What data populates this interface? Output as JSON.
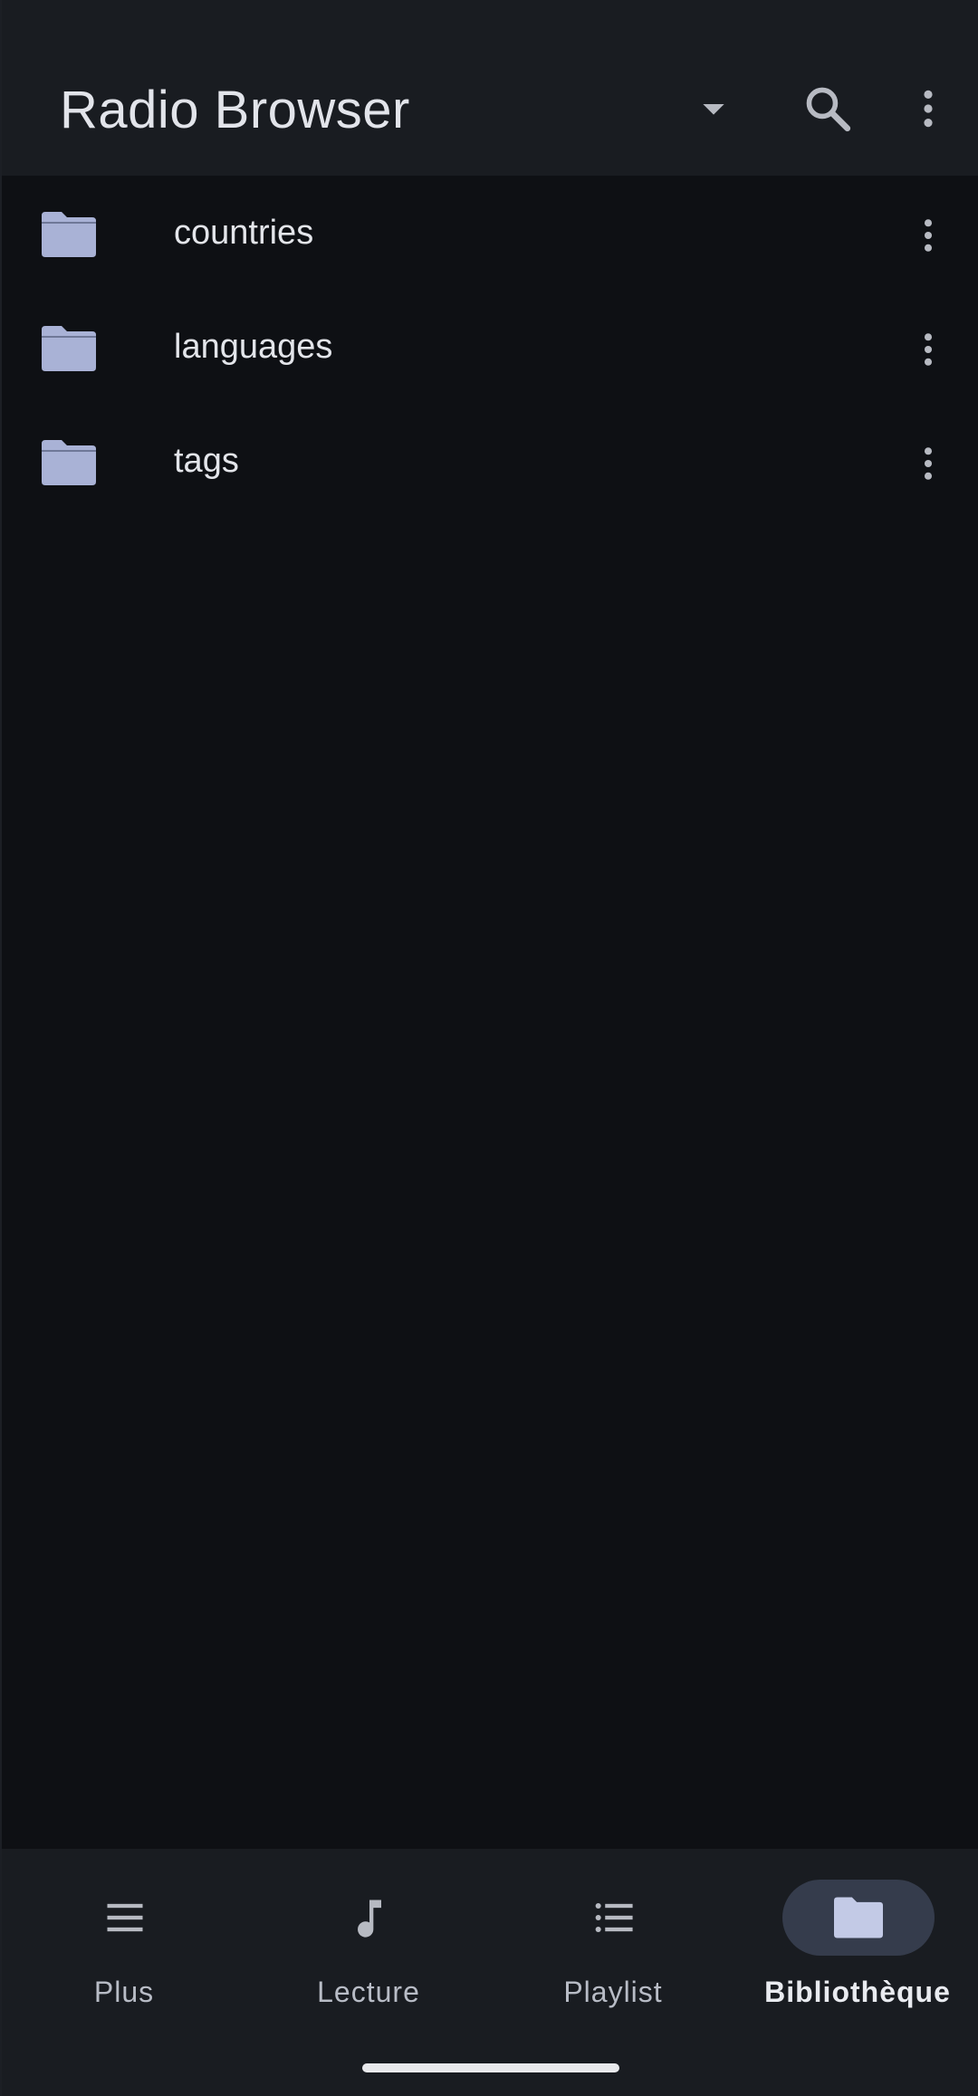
{
  "appbar": {
    "title": "Radio Browser",
    "icons": [
      "dropdown-arrow-icon",
      "search-icon",
      "more-vert-icon"
    ]
  },
  "list": {
    "items": [
      {
        "label": "countries",
        "icon": "folder-icon"
      },
      {
        "label": "languages",
        "icon": "folder-icon"
      },
      {
        "label": "tags",
        "icon": "folder-icon"
      }
    ]
  },
  "bottom_nav": {
    "items": [
      {
        "label": "Plus",
        "icon": "menu-icon",
        "active": false
      },
      {
        "label": "Lecture",
        "icon": "music-note-icon",
        "active": false
      },
      {
        "label": "Playlist",
        "icon": "playlist-icon",
        "active": false
      },
      {
        "label": "Bibliothèque",
        "icon": "folder-icon",
        "active": true
      }
    ]
  },
  "colors": {
    "background": "#0e1014",
    "bar_background": "#191c21",
    "folder": "#a9b2d6",
    "icon": "#b7bac2",
    "text": "#e3e5ea",
    "active_indicator": "#353c4c"
  }
}
